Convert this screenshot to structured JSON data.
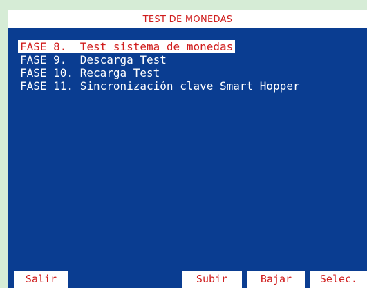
{
  "window": {
    "title": "TEST DE MONEDAS"
  },
  "menu": {
    "selected_index": 0,
    "items": [
      {
        "label": "FASE 8.  Test sistema de monedas"
      },
      {
        "label": "FASE 9.  Descarga Test"
      },
      {
        "label": "FASE 10. Recarga Test"
      },
      {
        "label": "FASE 11. Sincronización clave Smart Hopper"
      }
    ]
  },
  "softkeys": {
    "salir": "Salir",
    "subir": "Subir",
    "bajar": "Bajar",
    "selec": "Selec."
  },
  "colors": {
    "background": "#d6ecd6",
    "panel": "#0a3d91",
    "highlight_text": "#d01e1e",
    "normal_text": "#ffffff"
  }
}
